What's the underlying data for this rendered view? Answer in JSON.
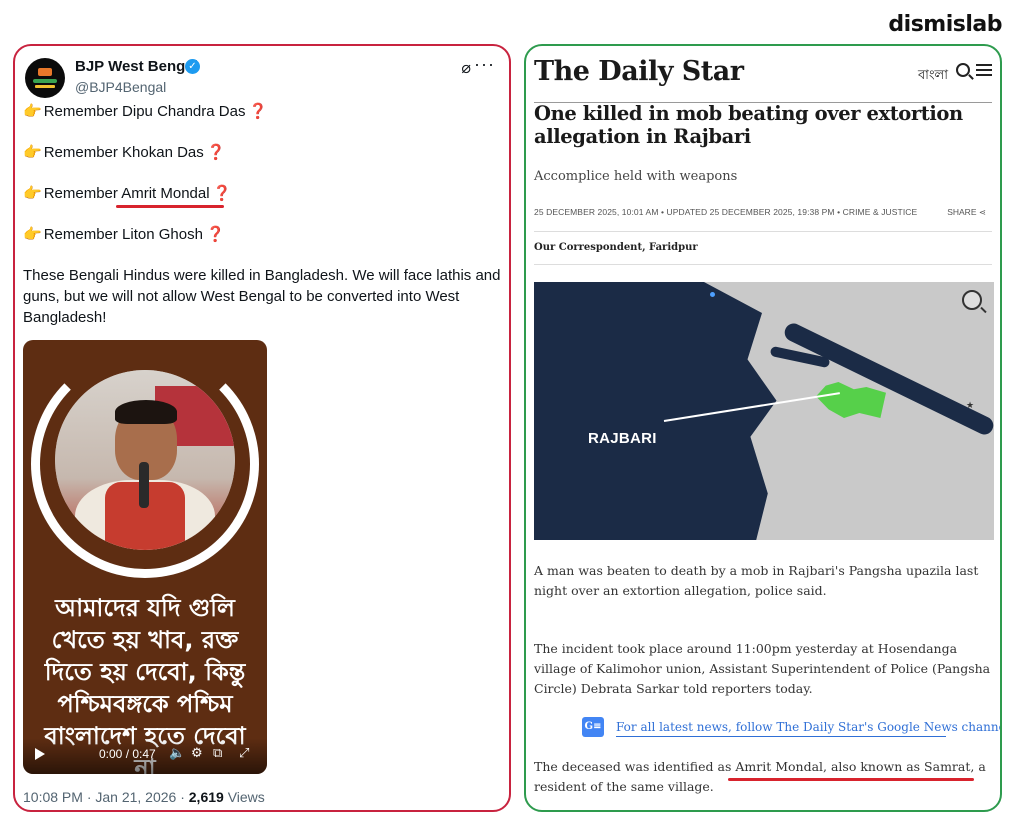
{
  "brand": "dismislab",
  "tweet": {
    "account_name": "BJP West Bengal",
    "handle": "@BJP4Bengal",
    "lines": [
      {
        "prefix": "Remember ",
        "name": "Dipu Chandra Das"
      },
      {
        "prefix": "Remember ",
        "name": "Khokan Das"
      },
      {
        "prefix": "Remember ",
        "name": "Amrit Mondal"
      },
      {
        "prefix": "Remember ",
        "name": "Liton Ghosh"
      }
    ],
    "body": "These Bengali Hindus were killed in Bangladesh. We will face lathis and guns, but we will not allow West Bengal to be converted into West Bangladesh!",
    "media_caption": "আমাদের যদি গুলি খেতে হয় খাব, রক্ত দিতে হয় দেবো, কিন্তু পশ্চিমবঙ্গকে পশ্চিম বাংলাদেশ হতে দেবো না",
    "video_time": "0:00 / 0:47",
    "timestamp": "10:08 PM · Jan 21, 2026 · ",
    "views_count": "2,619",
    "views_label": " Views",
    "icons": {
      "hand": "👉",
      "question": "❓"
    }
  },
  "article": {
    "masthead": "The Daily Star",
    "lang_label": "বাংলা",
    "headline": "One killed in mob beating over extortion allegation in Rajbari",
    "subhead": "Accomplice held with weapons",
    "dateline": "25 DECEMBER 2025, 10:01 AM • UPDATED 25 DECEMBER 2025, 19:38 PM • CRIME & JUSTICE",
    "share_label": "SHARE",
    "byline": "Our Correspondent, Faridpur",
    "map_label": "RAJBARI",
    "para1": "A man was beaten to death by a mob in Rajbari's Pangsha upazila last night over an extortion allegation, police said.",
    "para2": "The incident took place around 11:00pm yesterday at Hosendanga village of Kalimohor union, Assistant Superintendent of Police (Pangsha Circle) Debrata Sarkar told reporters today.",
    "gnews_text": "For all latest news, follow The Daily Star's Google News channel.",
    "para3": "The deceased was identified as Amrit Mondal, also known as Samrat, a resident of the same village."
  },
  "colors": {
    "tweet_border": "#c8233f",
    "article_border": "#2e9b4e",
    "underline": "#d8232d",
    "map_highlight": "#56d04a"
  }
}
